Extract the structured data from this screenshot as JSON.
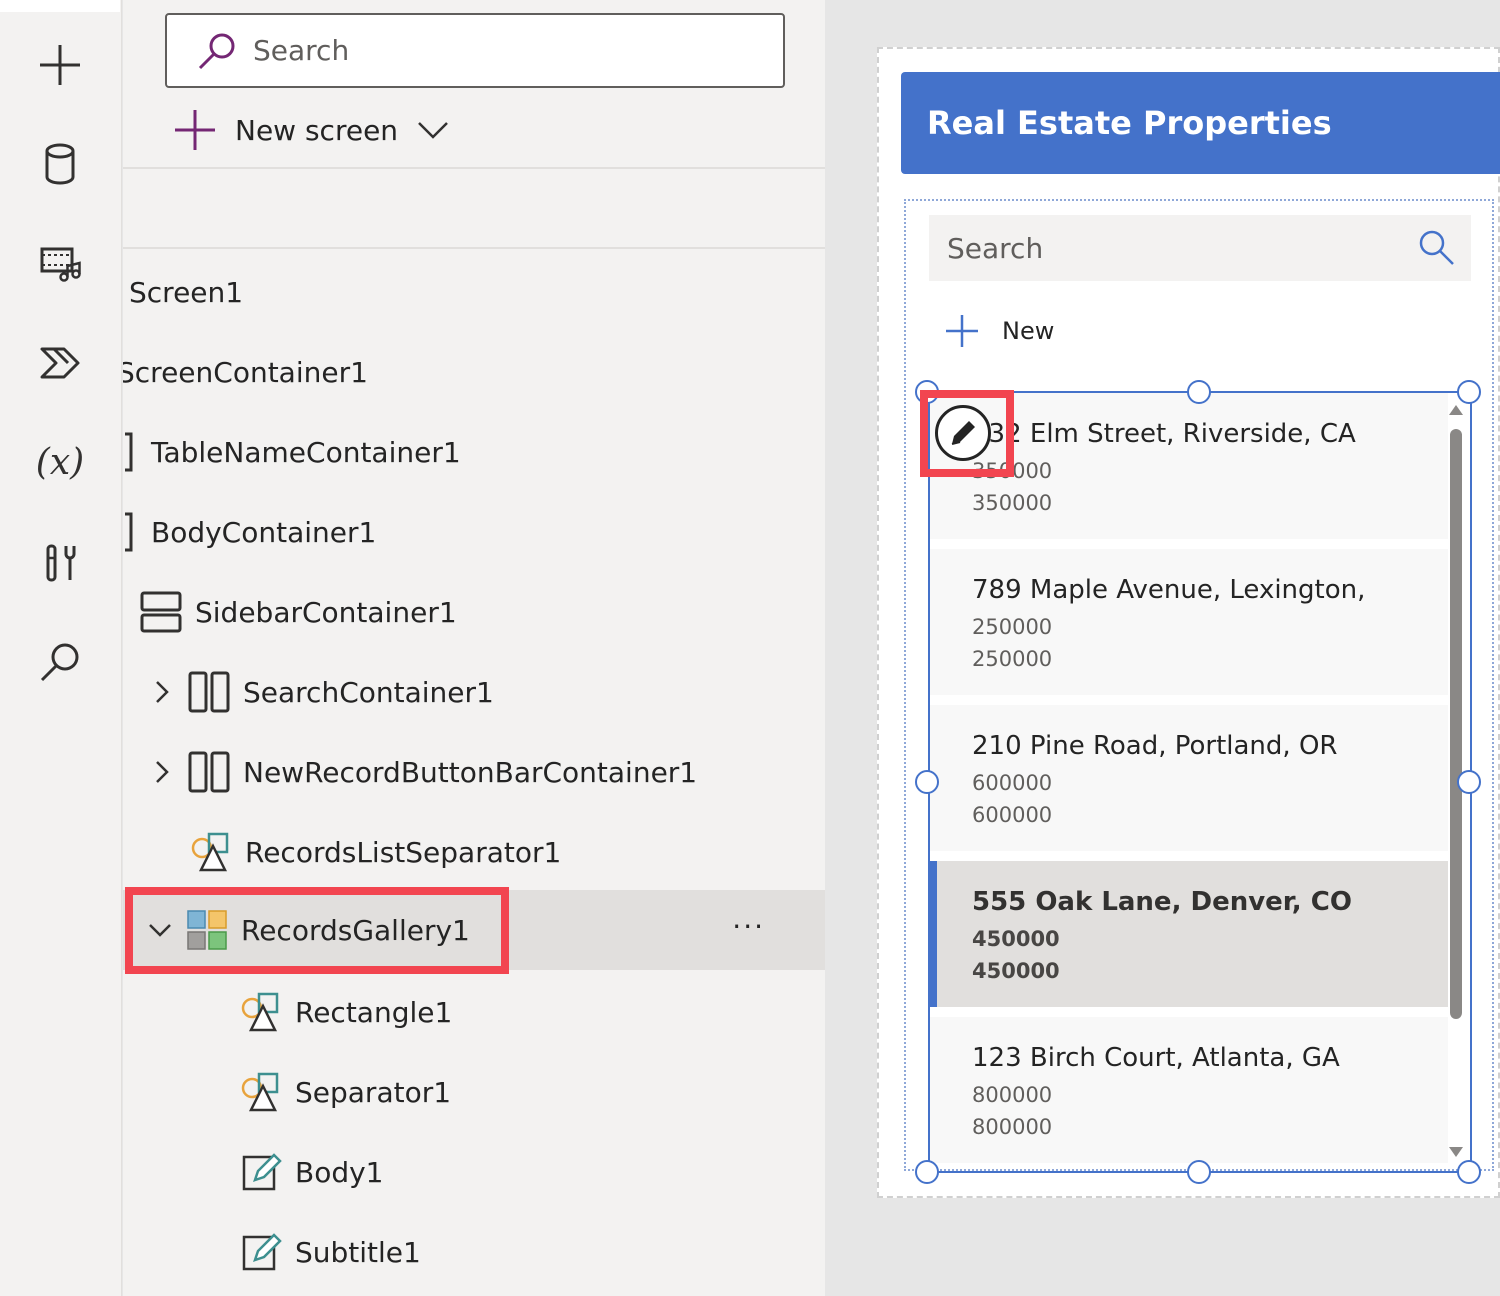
{
  "rail": {
    "icons": [
      "plus-icon",
      "database-icon",
      "media-icon",
      "power-automate-icon",
      "variables-icon",
      "tools-icon",
      "search-icon"
    ],
    "variables_label": "(x)"
  },
  "tree": {
    "search": {
      "placeholder": "Search"
    },
    "new_screen_label": "New screen",
    "nodes": [
      {
        "label": "Screen1",
        "icon": "screen-icon"
      },
      {
        "label": "ScreenContainer1",
        "icon": "container-icon"
      },
      {
        "label": "TableNameContainer1",
        "icon": "container-icon"
      },
      {
        "label": "BodyContainer1",
        "icon": "container-icon"
      },
      {
        "label": "SidebarContainer1",
        "icon": "vertical-container-icon"
      },
      {
        "label": "SearchContainer1",
        "icon": "horizontal-container-icon"
      },
      {
        "label": "NewRecordButtonBarContainer1",
        "icon": "horizontal-container-icon"
      },
      {
        "label": "RecordsListSeparator1",
        "icon": "shapes-icon"
      },
      {
        "label": "RecordsGallery1",
        "icon": "gallery-icon",
        "selected": true
      },
      {
        "label": "Rectangle1",
        "icon": "shapes-icon"
      },
      {
        "label": "Separator1",
        "icon": "shapes-icon"
      },
      {
        "label": "Body1",
        "icon": "text-edit-icon"
      },
      {
        "label": "Subtitle1",
        "icon": "text-edit-icon"
      }
    ],
    "more_label": "···"
  },
  "app": {
    "title": "Real Estate Properties",
    "search": {
      "placeholder": "Search"
    },
    "new_label": "New",
    "gallery": [
      {
        "address": "432 Elm Street, Riverside, CA",
        "price1": "350000",
        "price2": "350000"
      },
      {
        "address": "789 Maple Avenue, Lexington,",
        "price1": "250000",
        "price2": "250000"
      },
      {
        "address": "210 Pine Road, Portland, OR",
        "price1": "600000",
        "price2": "600000"
      },
      {
        "address": "555 Oak Lane, Denver, CO",
        "price1": "450000",
        "price2": "450000",
        "selected": true
      },
      {
        "address": "123 Birch Court, Atlanta, GA",
        "price1": "800000",
        "price2": "800000"
      }
    ]
  },
  "colors": {
    "accent": "#4472ca",
    "highlight": "#f24550",
    "panel": "#f3f2f1"
  }
}
